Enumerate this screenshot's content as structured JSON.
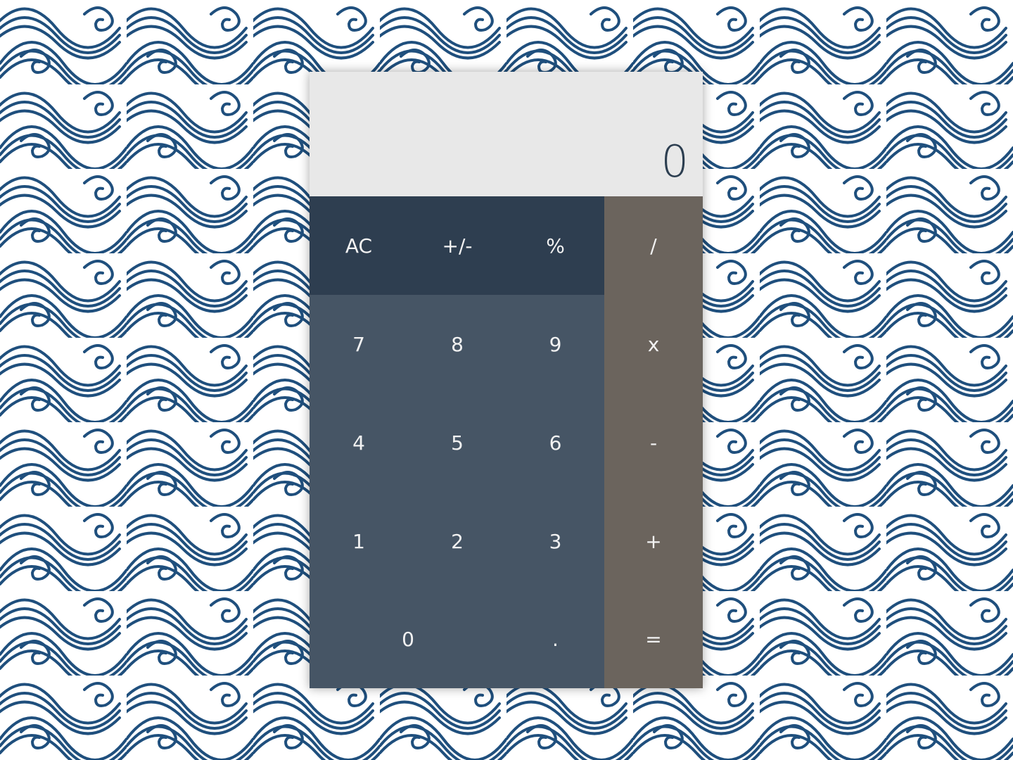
{
  "calculator": {
    "display": "0",
    "function_keys": [
      {
        "label": "AC",
        "name": "ac-button"
      },
      {
        "label": "+/-",
        "name": "toggle-sign-button"
      },
      {
        "label": "%",
        "name": "percent-button"
      }
    ],
    "digit_keys": [
      {
        "label": "7",
        "name": "digit-7-button"
      },
      {
        "label": "8",
        "name": "digit-8-button"
      },
      {
        "label": "9",
        "name": "digit-9-button"
      },
      {
        "label": "4",
        "name": "digit-4-button"
      },
      {
        "label": "5",
        "name": "digit-5-button"
      },
      {
        "label": "6",
        "name": "digit-6-button"
      },
      {
        "label": "1",
        "name": "digit-1-button"
      },
      {
        "label": "2",
        "name": "digit-2-button"
      },
      {
        "label": "3",
        "name": "digit-3-button"
      },
      {
        "label": "0",
        "name": "digit-0-button"
      },
      {
        "label": ".",
        "name": "decimal-button"
      }
    ],
    "operator_keys": [
      {
        "label": "/",
        "name": "divide-button"
      },
      {
        "label": "x",
        "name": "multiply-button"
      },
      {
        "label": "-",
        "name": "subtract-button"
      },
      {
        "label": "+",
        "name": "add-button"
      },
      {
        "label": "=",
        "name": "equals-button"
      }
    ]
  },
  "colors": {
    "display_bg": "#e8e8e8",
    "display_text": "#2c3e50",
    "function_row": "#2e3e50",
    "digit_area": "#465565",
    "operator_column": "#6b645d",
    "key_text": "#f2f2f2",
    "wave_ink": "#1f4f7d"
  }
}
